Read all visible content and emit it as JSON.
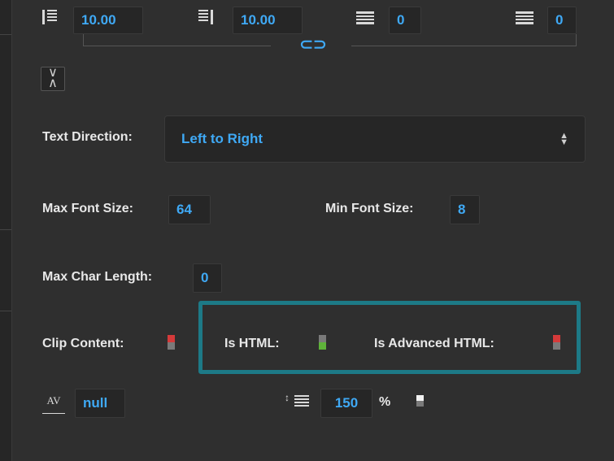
{
  "spacing": {
    "padding_left": "10.00",
    "padding_right": "10.00",
    "padding_top": "0",
    "padding_bottom": "0"
  },
  "text_direction": {
    "label": "Text Direction:",
    "value": "Left to Right"
  },
  "font_sizes": {
    "max_label": "Max Font Size:",
    "max_value": "64",
    "min_label": "Min Font Size:",
    "min_value": "8"
  },
  "char_length": {
    "label": "Max Char Length:",
    "value": "0"
  },
  "toggles": {
    "clip_content": {
      "label": "Clip Content:",
      "state": "off"
    },
    "is_html": {
      "label": "Is HTML:",
      "state": "on"
    },
    "is_advanced_html": {
      "label": "Is Advanced HTML:",
      "state": "off"
    }
  },
  "tracking": {
    "icon_text": "AV",
    "value": "null"
  },
  "line_spacing": {
    "value": "150",
    "unit": "%"
  },
  "colors": {
    "accent_text": "#3fa9f5",
    "highlight_border": "#1d7a87",
    "toggle_on": "#5fb33a",
    "toggle_off": "#d53a3a",
    "panel_bg": "#2f2f2f"
  }
}
